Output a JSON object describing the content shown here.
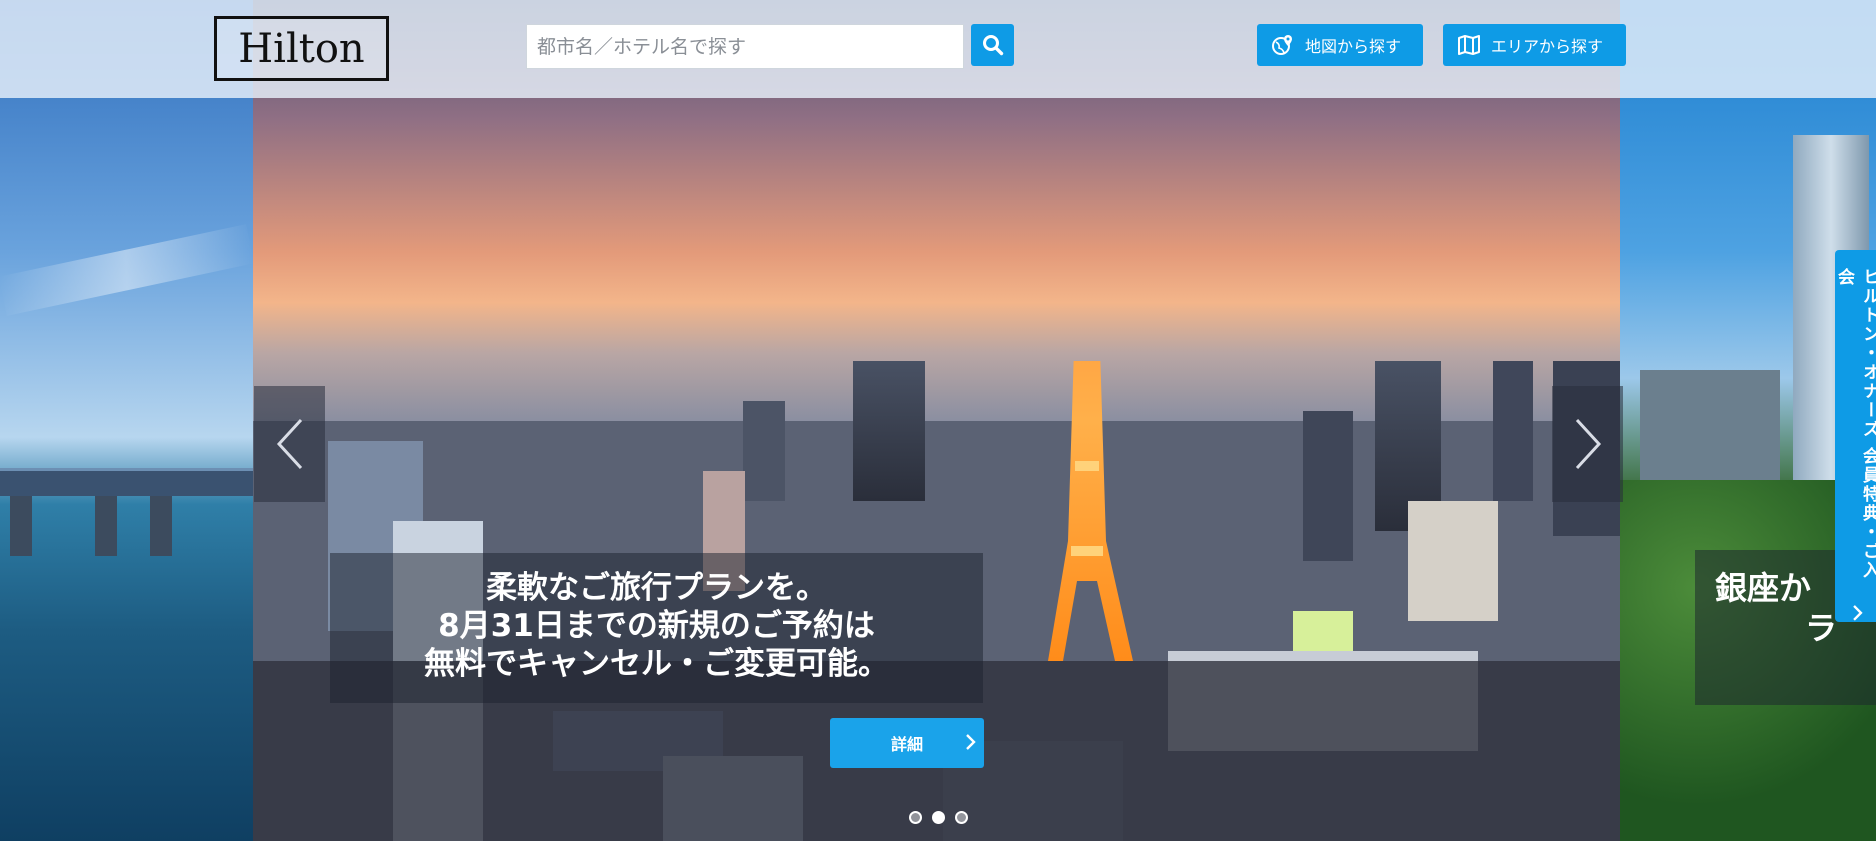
{
  "header": {
    "logo_text": "Hilton",
    "search_placeholder": "都市名／ホテル名で探す",
    "map_button_label": "地図から探す",
    "area_button_label": "エリアから探す"
  },
  "slide": {
    "caption_line1": "柔軟なご旅行プランを。",
    "caption_line2": "8月31日までの新規のご予約は",
    "caption_line3": "無料でキャンセル・ご変更可能。",
    "detail_button_label": "詳細"
  },
  "next_slide_caption": "銀座か",
  "next_slide_caption_line2": "ラ",
  "side_tab_label": "ヒルトン・オナーズ 会員特典・ご入会",
  "carousel": {
    "slide_count": 3,
    "active_index": 1
  },
  "colors": {
    "accent": "#0e9be6",
    "header_bg": "#e8f0fa"
  }
}
